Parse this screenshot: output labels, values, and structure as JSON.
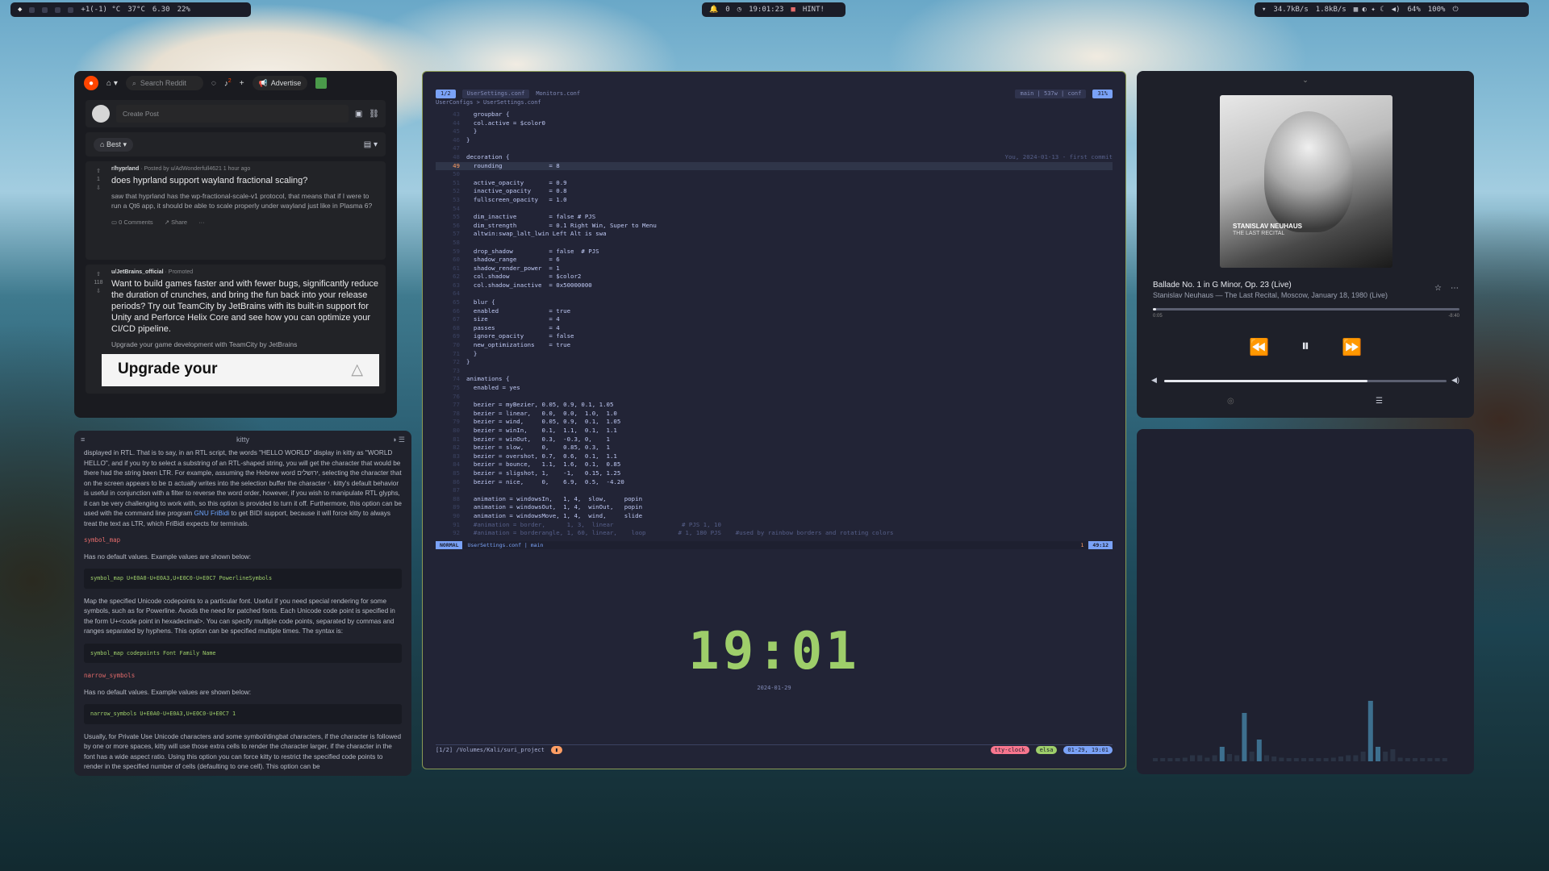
{
  "topbar": {
    "weather": "+1(-1) °C",
    "temp": "37°C",
    "load": "6.30",
    "battery_left": "22%",
    "notifications": "0",
    "time": "19:01:23",
    "hint": "HINT!",
    "net_down": "34.7kB/s",
    "net_up": "1.8kB/s",
    "volume": "64%",
    "brightness": "100%"
  },
  "reddit": {
    "search_placeholder": "Search Reddit",
    "advertise": "Advertise",
    "notif_count": "2",
    "create_post": "Create Post",
    "sort": "Best",
    "posts": [
      {
        "subreddit": "r/hyprland",
        "meta": "· Posted by u/AdWonderfull4621 1 hour ago",
        "votes": "1",
        "title": "does hyprland support wayland fractional scaling?",
        "body": "saw that hyprland has the wp-fractional-scale-v1 protocol, that means that if I were to run a Qt6 app, it should be able to scale properly under wayland just like in Plasma 6?",
        "comments": "0 Comments",
        "share": "Share"
      },
      {
        "subreddit": "u/JetBrains_official",
        "meta": "· Promoted",
        "votes": "118",
        "title": "Want to build games faster and with fewer bugs, significantly reduce the duration of crunches, and bring the fun back into your release periods? Try out TeamCity by JetBrains with its built-in support for Unity and Perforce Helix Core and see how you can optimize your CI/CD pipeline.",
        "body": "Upgrade your game development with TeamCity by JetBrains",
        "banner": "Upgrade your"
      }
    ]
  },
  "kitty": {
    "title": "kitty",
    "p1": "displayed in RTL. That is to say, in an RTL script, the words \"HELLO WORLD\" display in kitty as \"WORLD HELLO\", and if you try to select a substring of an RTL-shaped string, you will get the character that would be there had the string been LTR. For example, assuming the Hebrew word ירושלים, selecting the character that on the screen appears to be ם actually writes into the selection buffer the character י. kitty's default behavior is useful in conjunction with a filter to reverse the word order, however, if you wish to manipulate RTL glyphs, it can be very challenging to work with, so this option is provided to turn it off. Furthermore, this option can be used with the command line program",
    "link": "GNU FriBidi",
    "p1_end": "to get BIDI support, because it will force kitty to always treat the text as LTR, which FriBidi expects for terminals.",
    "h1": "symbol_map",
    "nodefault1": "Has no default values. Example values are shown below:",
    "code1": "symbol_map U+E0A0-U+E0A3,U+E0C0-U+E0C7 PowerlineSymbols",
    "p2": "Map the specified Unicode codepoints to a particular font. Useful if you need special rendering for some symbols, such as for Powerline. Avoids the need for patched fonts. Each Unicode code point is specified in the form U+<code point in hexadecimal>. You can specify multiple code points, separated by commas and ranges separated by hyphens. This option can be specified multiple times. The syntax is:",
    "code2": "symbol_map codepoints Font Family Name",
    "h2": "narrow_symbols",
    "nodefault2": "Has no default values. Example values are shown below:",
    "code3": "narrow_symbols U+E0A0-U+E0A3,U+E0C0-U+E0C7 1",
    "p3": "Usually, for Private Use Unicode characters and some symbol/dingbat characters, if the character is followed by one or more spaces, kitty will use those extra cells to render the character larger, if the character in the font has a wide aspect ratio. Using this option you can force kitty to restrict the specified code points to render in the specified number of cells (defaulting to one cell). This option can be"
  },
  "nvim": {
    "tab_index": "1/2",
    "tab1": "UserSettings.conf",
    "tab2": "Monitors.conf",
    "git": "main | 537w | conf",
    "percent": "31%",
    "crumb": "UserConfigs > UserSettings.conf",
    "blame": "You, 2024-01-13 - first commit",
    "lines": [
      {
        "n": "43",
        "t": "  groupbar {"
      },
      {
        "n": "44",
        "t": "  col.active = $color0"
      },
      {
        "n": "45",
        "t": "  }"
      },
      {
        "n": "46",
        "t": "}"
      },
      {
        "n": "47",
        "t": ""
      },
      {
        "n": "48",
        "t": "decoration {"
      },
      {
        "n": "49",
        "t": "  rounding             = 8"
      },
      {
        "n": "50",
        "t": ""
      },
      {
        "n": "51",
        "t": "  active_opacity       = 0.9"
      },
      {
        "n": "52",
        "t": "  inactive_opacity     = 0.8"
      },
      {
        "n": "53",
        "t": "  fullscreen_opacity   = 1.0"
      },
      {
        "n": "54",
        "t": ""
      },
      {
        "n": "55",
        "t": "  dim_inactive         = false # PJS"
      },
      {
        "n": "56",
        "t": "  dim_strength         = 0.1 Right Win, Super to Menu"
      },
      {
        "n": "57",
        "t": "  altwin:swap_lalt_lwin Left Alt is swa"
      },
      {
        "n": "58",
        "t": ""
      },
      {
        "n": "59",
        "t": "  drop_shadow          = false  # PJS"
      },
      {
        "n": "60",
        "t": "  shadow_range         = 6"
      },
      {
        "n": "61",
        "t": "  shadow_render_power  = 1"
      },
      {
        "n": "62",
        "t": "  col.shadow           = $color2"
      },
      {
        "n": "63",
        "t": "  col.shadow_inactive  = 0x50000000"
      },
      {
        "n": "64",
        "t": ""
      },
      {
        "n": "65",
        "t": "  blur {"
      },
      {
        "n": "66",
        "t": "  enabled              = true"
      },
      {
        "n": "67",
        "t": "  size                 = 4"
      },
      {
        "n": "68",
        "t": "  passes               = 4"
      },
      {
        "n": "69",
        "t": "  ignore_opacity       = false"
      },
      {
        "n": "70",
        "t": "  new_optimizations    = true"
      },
      {
        "n": "71",
        "t": "  }"
      },
      {
        "n": "72",
        "t": "}"
      },
      {
        "n": "73",
        "t": ""
      },
      {
        "n": "74",
        "t": "animations {"
      },
      {
        "n": "75",
        "t": "  enabled = yes"
      },
      {
        "n": "76",
        "t": ""
      },
      {
        "n": "77",
        "t": "  bezier = myBezier, 0.05, 0.9, 0.1, 1.05"
      },
      {
        "n": "78",
        "t": "  bezier = linear,   0.0,  0.0,  1.0,  1.0"
      },
      {
        "n": "79",
        "t": "  bezier = wind,     0.05, 0.9,  0.1,  1.05"
      },
      {
        "n": "80",
        "t": "  bezier = winIn,    0.1,  1.1,  0.1,  1.1"
      },
      {
        "n": "81",
        "t": "  bezier = winOut,   0.3,  -0.3, 0,    1"
      },
      {
        "n": "82",
        "t": "  bezier = slow,     0,    0.85, 0.3,  1"
      },
      {
        "n": "83",
        "t": "  bezier = overshot, 0.7,  0.6,  0.1,  1.1"
      },
      {
        "n": "84",
        "t": "  bezier = bounce,   1.1,  1.6,  0.1,  0.85"
      },
      {
        "n": "85",
        "t": "  bezier = sligshot, 1,    -1,   0.15, 1.25"
      },
      {
        "n": "86",
        "t": "  bezier = nice,     0,    6.9,  0.5,  -4.20"
      },
      {
        "n": "87",
        "t": ""
      },
      {
        "n": "88",
        "t": "  animation = windowsIn,   1, 4,  slow,     popin"
      },
      {
        "n": "89",
        "t": "  animation = windowsOut,  1, 4,  winOut,   popin"
      },
      {
        "n": "90",
        "t": "  animation = windowsMove, 1, 4,  wind,     slide"
      },
      {
        "n": "91",
        "t": "  #animation = border,      1, 3,  linear                   # PJS 1, 10"
      },
      {
        "n": "92",
        "t": "  #animation = borderangle, 1, 60, linear,    loop         # 1, 180 PJS    #used by rainbow borders and rotating colors"
      }
    ],
    "mode": "NORMAL",
    "status_file": "UserSettings.conf | main",
    "status_pos": "49:12",
    "status_diag": "1",
    "clock": "19:01",
    "clock_date": "2024-01-29",
    "tmux_path": "[1/2] /Volumes/Kali/suri_project",
    "tmux_pill1": "tty-clock",
    "tmux_pill2": "elsa",
    "tmux_pill3": "01-29, 19:01"
  },
  "music": {
    "cover_artist": "STANISLAV NEUHAUS",
    "cover_album": "THE LAST RECITAL",
    "title": "Ballade No. 1 in G Minor, Op. 23 (Live)",
    "artist": "Stanislav Neuhaus — The Last Recital, Moscow, January 18, 1980 (Live)",
    "elapsed": "0:05",
    "remaining": "-8:40",
    "progress": 0.01,
    "volume": 0.72
  },
  "visualizer": {
    "bars": [
      0.01,
      0.01,
      0.02,
      0.02,
      0.03,
      0.05,
      0.05,
      0.03,
      0.05,
      0.12,
      0.06,
      0.05,
      0.4,
      0.08,
      0.18,
      0.05,
      0.04,
      0.03,
      0.02,
      0.02,
      0.02,
      0.01,
      0.01,
      0.02,
      0.03,
      0.04,
      0.05,
      0.05,
      0.08,
      0.5,
      0.12,
      0.08,
      0.1,
      0.03,
      0.02,
      0.02,
      0.01,
      0.01,
      0.01,
      0.01
    ]
  },
  "colors": {
    "accent": "#7aa2f7",
    "green": "#9ece6a",
    "orange": "#ff9e64",
    "reddit": "#ff4500"
  }
}
